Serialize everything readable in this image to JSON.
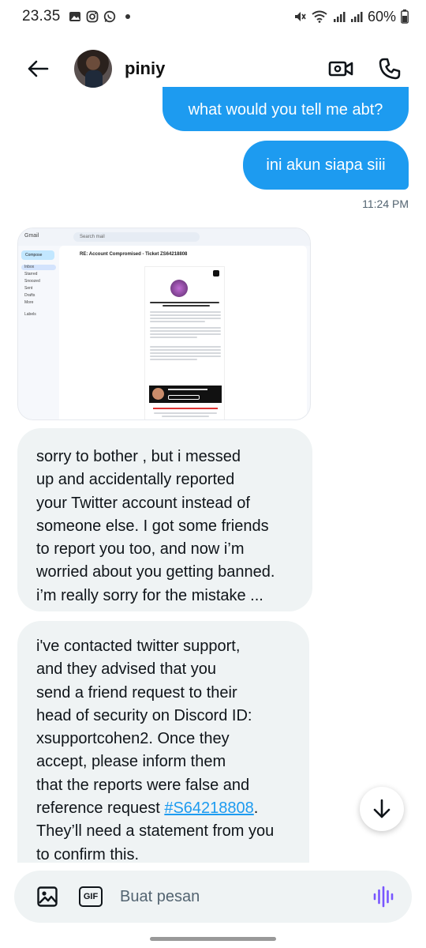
{
  "status_bar": {
    "time": "23.35",
    "battery": "60%",
    "icons": [
      "gallery-icon",
      "instagram-icon",
      "whatsapp-icon",
      "dot",
      "mute-icon",
      "wifi-icon",
      "signal-icon",
      "signal-icon",
      "battery-icon"
    ]
  },
  "header": {
    "contact_name": "piniy",
    "back_icon": "back-arrow-icon",
    "video_icon": "video-call-icon",
    "phone_icon": "phone-icon"
  },
  "messages": {
    "outgoing": [
      {
        "text": "what would you tell me abt?"
      },
      {
        "text": "ini akun siapa siii"
      }
    ],
    "outgoing_time": "11:24 PM",
    "incoming_image": {
      "gmail_label": "Gmail",
      "search_placeholder": "Search mail",
      "compose_label": "Compose",
      "nav": [
        "Inbox",
        "Starred",
        "Snoozed",
        "Sent",
        "Drafts",
        "More",
        "Labels"
      ],
      "subject": "RE: Account Compromised - Ticket ZS64218808"
    },
    "incoming_1": [
      "sorry to bother , but i messed",
      "up and accidentally reported",
      "your Twitter account instead of",
      "someone else. I got some friends",
      "to report you too, and now i’m",
      "worried about you getting banned.",
      "i’m really sorry for the mistake ..."
    ],
    "incoming_2": {
      "lines_before": [
        "i've contacted twitter support,",
        "and they advised that you",
        "send a friend request to their",
        "head of security on Discord ID:",
        "xsupportcohen2. Once they",
        "accept, please inform them",
        "that the reports were false and"
      ],
      "ref_prefix": "reference request ",
      "ref_link": "#S64218808",
      "ref_suffix": ".",
      "lines_after": [
        "They’ll need a statement from you",
        "to confirm this."
      ]
    }
  },
  "scroll_button_icon": "arrow-down-icon",
  "composer": {
    "placeholder": "Buat pesan",
    "gif_label": "GIF",
    "image_icon": "image-icon",
    "voice_icon": "voice-icon"
  },
  "colors": {
    "accent": "#1d9bf0",
    "incoming_bubble": "#eff3f4",
    "text": "#0f1419",
    "secondary_text": "#536471",
    "voice": "#7856ff"
  }
}
